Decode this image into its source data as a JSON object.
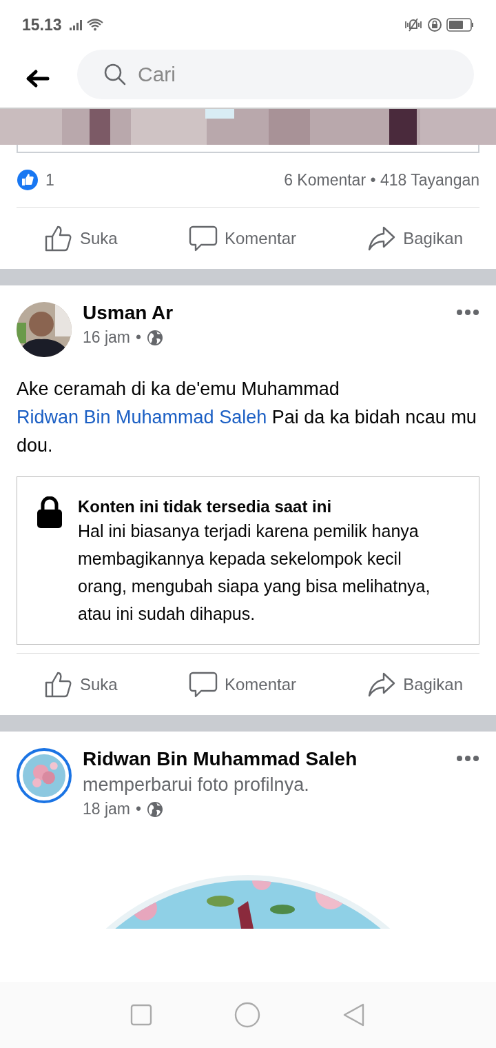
{
  "status_bar": {
    "time": "15.13"
  },
  "search": {
    "placeholder": "Cari"
  },
  "top_post": {
    "reactions": {
      "count": "1"
    },
    "stats": "6 Komentar • 418 Tayangan",
    "actions": [
      {
        "kind": "like",
        "label": "Suka"
      },
      {
        "kind": "comment",
        "label": "Komentar"
      },
      {
        "kind": "share",
        "label": "Bagikan"
      }
    ]
  },
  "post": {
    "author": "Usman Ar",
    "time": "16 jam",
    "separator": "•",
    "text": {
      "before": "Ake ceramah di ka de'emu Muhammad",
      "link": "Ridwan Bin Muhammad Saleh",
      "after": "Pai da ka bidah ncau mu dou."
    },
    "notice": {
      "title": "Konten ini tidak tersedia saat ini",
      "body": "Hal ini biasanya terjadi karena pemilik hanya membagikannya kepada sekelompok kecil orang, mengubah siapa yang bisa melihatnya, atau ini sudah dihapus."
    },
    "actions": [
      {
        "kind": "like",
        "label": "Suka"
      },
      {
        "kind": "comment",
        "label": "Komentar"
      },
      {
        "kind": "share",
        "label": "Bagikan"
      }
    ]
  },
  "profile_post": {
    "author": "Ridwan Bin Muhammad Saleh",
    "activity": "memperbarui foto profilnya.",
    "time": "18 jam",
    "separator": "•",
    "story_ring": true
  }
}
